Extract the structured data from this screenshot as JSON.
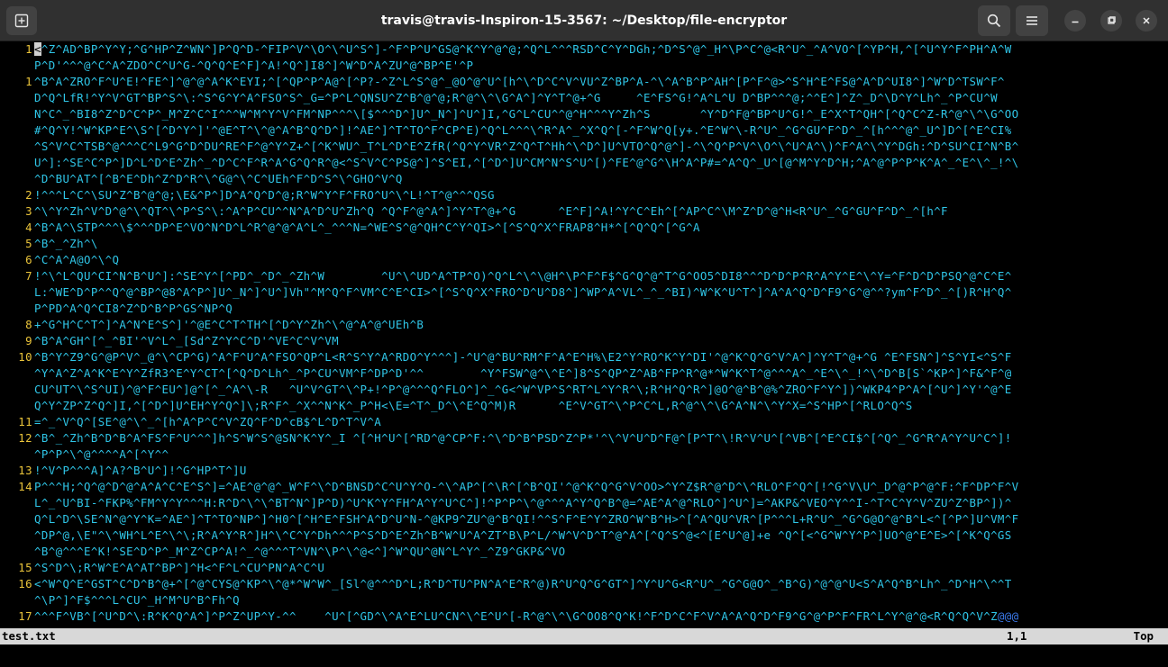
{
  "window": {
    "title": "travis@travis-Inspiron-15-3567: ~/Desktop/file-encryptor"
  },
  "buttons": {
    "new_tab_icon": "new-tab-icon",
    "search_icon": "search-icon",
    "menu_icon": "hamburger-menu-icon",
    "minimize_icon": "minimize-icon",
    "maximize_icon": "maximize-icon",
    "close_icon": "close-icon"
  },
  "colors": {
    "terminal_bg": "#000000",
    "text": "#2fc6e8",
    "line_number": "#eac43a",
    "titlebar": "#303030",
    "statusbar": "#d8d8d8"
  },
  "editor": {
    "lines": [
      {
        "num": "1",
        "first_char": "<",
        "text": "^Z^AD^BP^Y^Y;^G^HP^Z^WN^]P^Q^D-^FIP^V^\\O^\\^U^S^]-^F^P^U^GS@^K^Y^@^@;^Q^L^^^RSD^C^Y^DGh;^D^S^@^_H^\\P^C^@<R^U^_^A^VO^[^YP^H,^[^U^Y^F^PH^A^W"
      },
      {
        "num": "",
        "text": "P^D'^^^@^C^A^ZDO^C^U^G-^Q^Q^E^F]^A!^Q^]I8^]^W^D^A^ZU^@^BP^E'^P"
      },
      {
        "num": "1",
        "text": "^B^A^ZRO^F^U^E!^FE^]^@^@^A^K^EYI;^[^QP^P^A@^[^P?-^Z^L^S^@^_@O^@^U^[h^\\^D^C^V^VU^Z^BP^A-^\\^A^B^P^AH^[P^F^@>^S^H^E^FS@^A^D^UI8^]^W^D^TSW^F^"
      },
      {
        "num": "",
        "text": "D^Q^LfR!^Y^V^GT^BP^S^\\:^S^G^Y^A^FSO^S^_G=^P^L^QNSU^Z^B^@^@;R^@^\\^\\G^A^]^Y^T^@+^G     ^E^FS^G!^A^L^U D^BP^^^@;^^E^]^Z^_D^\\D^Y^Lh^_^P^CU^W"
      },
      {
        "num": "",
        "text": "N^C^_^BI8^Z^D^C^P^_M^Z^C^I^^^W^M^Y^V^FM^NP^^^\\[$^^^D^]U^_N^]^U^]I,^G^L^CU^^@^H^^^Y^Zh^S       ^Y^D^F@^BP^U^G!^_E^X^T^QH^[^Q^C^Z-R^@^\\^\\G^OO"
      },
      {
        "num": "",
        "text": "#^Q^Y!^W^KP^E^\\S^[^D^Y^]'^@E^T^\\^@^A^B^Q^D^]!^AE^]^T^TO^F^CP^E)^Q^L^^^\\^R^A^_^X^Q^[-^F^W^Q[y+.^E^W^\\-R^U^_^G^GU^F^D^_^[h^^^@^_U^]D^[^E^CI%"
      },
      {
        "num": "",
        "text": "^S^V^C^TSB^@^^^C^L9^G^D^DU^RE^F^@^Y^Z+^[^K^WU^_T^L^D^E^ZfR(^Q^Y^VR^Z^Q^T^Hh^\\^D^]U^VTO^Q^@^]-^\\^Q^P^V^\\O^\\^U^A^\\)^F^A^\\^Y^DGh:^D^SU^CI^N^B^"
      },
      {
        "num": "",
        "text": "U^]:^SE^C^P^]D^L^D^E^Zh^_^D^C^F^R^A^G^Q^R^@<^S^V^C^PS@^]^S^EI,^[^D^]U^CM^N^S^U^[)^FE^@^G^\\H^A^P#=^A^Q^_U^[@^M^Y^D^H;^A^@^P^P^K^A^_^E^\\^_!^\\"
      },
      {
        "num": "",
        "text": "^D^BU^AT^[^B^E^Dh^Z^D^R^\\^G@^\\^C^UEh^F^D^S^\\^GHO^V^Q"
      },
      {
        "num": "2",
        "text": "!^^^L^C^\\SU^Z^B^@^@;\\E&^P^]D^A^Q^D^@;R^W^Y^F^FRO^U^\\^L!^T^@^^^QSG"
      },
      {
        "num": "3",
        "text": "^\\^Y^Zh^V^D^@^\\^QT^\\^P^S^\\:^A^P^CU^^N^A^D^U^Zh^Q ^Q^F^@^A^]^Y^T^@+^G      ^E^F]^A!^Y^C^Eh^[^AP^C^\\M^Z^D^@^H<R^U^_^G^GU^F^D^_^[h^F"
      },
      {
        "num": "4",
        "text": "^B^A^\\STP^^^\\$^^^DP^E^VO^N^D^L^R^@^@^A^L^_^^^N=^WE^S^@^QH^C^Y^QI>^[^S^Q^X^FRAP8^H*^[^Q^Q^[^G^A"
      },
      {
        "num": "5",
        "text": "^B^_^Zh^\\"
      },
      {
        "num": "6",
        "text": "^C^A^A@O^\\^Q"
      },
      {
        "num": "7",
        "text": "!^\\^L^QU^CI^N^B^U^]:^SE^Y^[^PD^_^D^_^Zh^W        ^U^\\^UD^A^TP^O)^Q^L^\\^\\@H^\\P^F^F$^G^Q^@^T^G^OO5^DI8^^^D^D^P^R^A^Y^E^\\^Y=^F^D^D^PSQ^@^C^E^"
      },
      {
        "num": "",
        "text": "L:^WE^D^P^^Q^@^BP^@8^A^P^]U^_N^]^U^]Vh\"^M^Q^F^VM^C^E^CI>^[^S^Q^X^FRO^D^U^D8^]^WP^A^VL^_^_^BI)^W^K^U^T^]^A^A^Q^D^F9^G^@^^?ym^F^D^_^[)R^H^Q^"
      },
      {
        "num": "",
        "text": "P^PD^A^Q^CI8^Z^D^B^P^GS^NP^Q"
      },
      {
        "num": "8",
        "text": "+^G^H^C^T^]^A^N^E^S^]'^@E^C^T^TH^[^D^Y^Zh^\\^@^A^@^UEh^B"
      },
      {
        "num": "9",
        "text": "^B^A^GH^[^_^BI'^V^L^_[Sd^Z^Y^C^D'^VE^C^V^VM"
      },
      {
        "num": "10",
        "text": "^B^Y^Z9^G^@P^V^_@^\\^CP^G)^A^F^U^A^FSO^QP^L<R^S^Y^A^RDO^Y^^^]-^U^@^BU^RM^F^A^E^H%\\E2^Y^RO^K^Y^DI'^@^K^Q^G^V^A^]^Y^T^@+^G ^E^FSN^]^S^YI<^S^F"
      },
      {
        "num": "",
        "text": "^Y^A^Z^A^K^E^Y^ZfR3^E^Y^CT^[^Q^D^Lh^_^P^CU^VM^F^DP^D'^^        ^Y^FSW^@^\\^E^]8^S^QP^Z^AB^FP^R^@*^W^K^T^@^^^A^_^E^\\^_!^\\^D^B[S`^KP^]^F&^F^@"
      },
      {
        "num": "",
        "text": "CU^UT^\\^S^UI)^@^F^EU^]@^[^_^A^\\-R   ^U^V^GT^\\^P+!^P^@^^^Q^FLO^]^_^G<^W^VP^S^RT^L^Y^R^\\;R^H^Q^R^]@O^@^B^@%^ZRO^F^Y^])^WKP4^P^A^[^U^]^Y'^@^E"
      },
      {
        "num": "",
        "text": "Q^Y^ZP^Z^Q^]I,^[^D^]U^EH^Y^Q^]\\;R^F^_^X^^N^K^_P^H<\\E=^T^_D^\\^E^Q^M)R      ^E^V^GT^\\^P^C^L,R^@^\\^\\G^A^N^\\^Y^X=^S^HP^[^RLO^Q^S"
      },
      {
        "num": "11",
        "text": "=^_^V^Q^[SE^@^\\^_^[h^A^P^C^V^ZQ^F^D^cB$^L^D^T^V^A"
      },
      {
        "num": "12",
        "text": "^B^_^Zh^B^D^B^A^FS^F^U^^^]h^S^W^S^@SN^K^Y^_I ^[^H^U^[^RD^@^CP^F:^\\^D^B^PSD^Z^P*'^\\^V^U^D^F@^[P^T^\\!R^V^U^[^VB^[^E^CI$^[^Q^_^G^R^A^Y^U^C^]!"
      },
      {
        "num": "",
        "text": "^P^P^\\^@^^^^A^[^Y^^"
      },
      {
        "num": "13",
        "text": "!^V^P^^^A]^A?^B^U^]!^G^HP^T^]U"
      },
      {
        "num": "14",
        "text": "P^^^H;^Q^@^D^@^A^A^C^E^S^]=^AE^@^@^_W^F^\\^D^BNSD^C^U^Y^O-^\\^AP^[^\\R^[^B^QI'^@^K^Q^G^V^OO>^Y^Z$R^@^D^\\^RLO^F^Q^[!^G^V\\U^_D^@^P^@^F:^F^DP^F^V"
      },
      {
        "num": "",
        "text": "L^_^U^BI-^FKP%^FM^Y^Y^^^H:R^D^\\^\\^BT^N^]P^D)^U^K^Y^FH^A^Y^U^C^]!^P^P^\\^@^^^A^Y^Q^B^@=^AE^A^@^RLO^]^U^]=^AKP&^VEO^Y^^I-^T^C^Y^V^ZU^Z^BP^])^"
      },
      {
        "num": "",
        "text": "Q^L^D^\\SE^N^@^Y^K=^AE^]^T^TO^NP^]^H0^[^H^E^FSH^A^D^U^N-^@KP9^ZU^@^B^QI!^^S^F^E^Y^ZRO^W^B^H>^[^A^QU^VR^[P^^^L+R^U^_^G^G@O^@^B^L<^[^P^]U^VM^F"
      },
      {
        "num": "",
        "text": "^DP^@,\\E\"^\\^WH^L^E^\\^\\;R^A^Y^R^]H^\\^C^Y^Dh^^^P^S^D^E^Zh^B^W^U^A^ZT^B\\P^L/^W^V^D^T^@^A^[^Q^S^@<^[E^U^@]+e ^Q^[<^G^W^Y^P^]UO^@^E^E>^[^K^Q^GS"
      },
      {
        "num": "",
        "text": "^B^@^^^E^K!^SE^D^P^_M^Z^CP^A!^_^@^^^T^VN^\\P^\\^@<^]^W^QU^@N^L^Y^_^Z9^GKP&^VO"
      },
      {
        "num": "15",
        "text": "^S^D^\\;R^W^E^A^AT^BP^]^H<^F^L^CU^PN^A^C^U"
      },
      {
        "num": "16",
        "text": "<^W^Q^E^GST^C^D^B^@+^[^@^CYS@^KP^\\^@*^W^W^_[Sl^@^^^D^L;R^D^TU^PN^A^E^R^@)R^U^Q^G^GT^]^Y^U^G<R^U^_^G^G@O^_^B^G)^@^@^U<S^A^Q^B^Lh^_^D^H^\\^^T"
      },
      {
        "num": "",
        "text": "^\\P^]^F$^^^L^CU^_H^M^U^B^Fh^Q"
      },
      {
        "num": "17",
        "text": "^^^F^VB^[^U^D^\\:R^K^Q^A^]^P^Z^UP^Y-^^    ^U^[^GD^\\^A^E^LU^CN^\\^E^U^[-R^@^\\^\\G^OO8^Q^K!^F^D^C^F^V^A^A^Q^D^F9^G^@^P^F^FR^L^Y^@^@<R^Q^Q^V^Z",
        "tail": "@@@"
      }
    ]
  },
  "statusbar": {
    "filename": "test.txt",
    "position": "1,1",
    "scroll": "Top"
  }
}
